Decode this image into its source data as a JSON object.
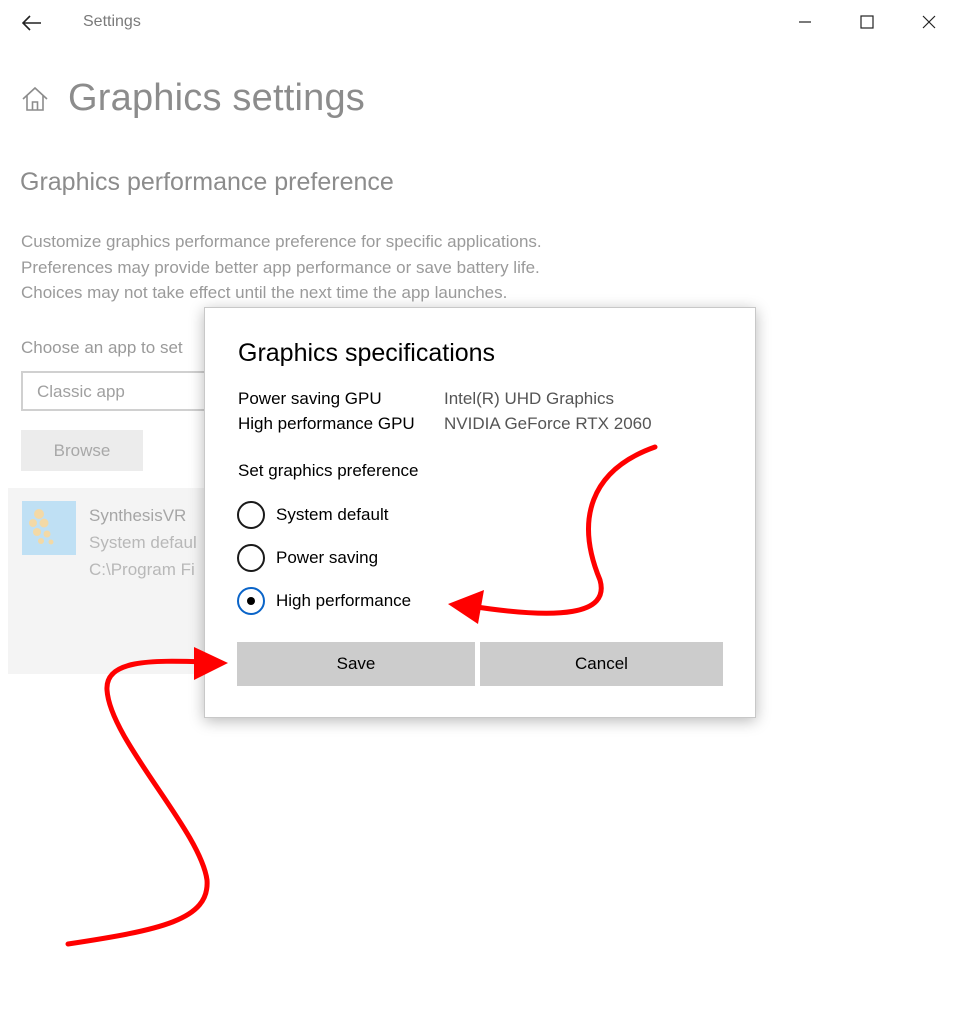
{
  "window": {
    "title": "Settings",
    "back_icon": "back-arrow-icon",
    "minimize_icon": "minimize-icon",
    "maximize_icon": "maximize-icon",
    "close_icon": "close-icon"
  },
  "page": {
    "home_icon": "home-icon",
    "title": "Graphics settings",
    "section_heading": "Graphics performance preference",
    "description_lines": [
      "Customize graphics performance preference for specific applications.",
      "Preferences may provide better app performance or save battery life.",
      "Choices may not take effect until the next time the app launches."
    ],
    "choose_label": "Choose an app to set",
    "app_type_value": "Classic app",
    "browse_label": "Browse",
    "app_item": {
      "name": "SynthesisVR",
      "preference": "System defaul",
      "path": "C:\\Program Fi"
    }
  },
  "dialog": {
    "title": "Graphics specifications",
    "specs": [
      {
        "label": "Power saving GPU",
        "value": "Intel(R) UHD Graphics"
      },
      {
        "label": "High performance GPU",
        "value": "NVIDIA GeForce RTX 2060"
      }
    ],
    "preference_label": "Set graphics preference",
    "options": [
      {
        "label": "System default",
        "checked": false
      },
      {
        "label": "Power saving",
        "checked": false
      },
      {
        "label": "High performance",
        "checked": true
      }
    ],
    "save_label": "Save",
    "cancel_label": "Cancel"
  },
  "colors": {
    "annotation_arrow": "#ff0000",
    "radio_selected_border": "#0a64c8",
    "dialog_button_bg": "#cccccc"
  }
}
